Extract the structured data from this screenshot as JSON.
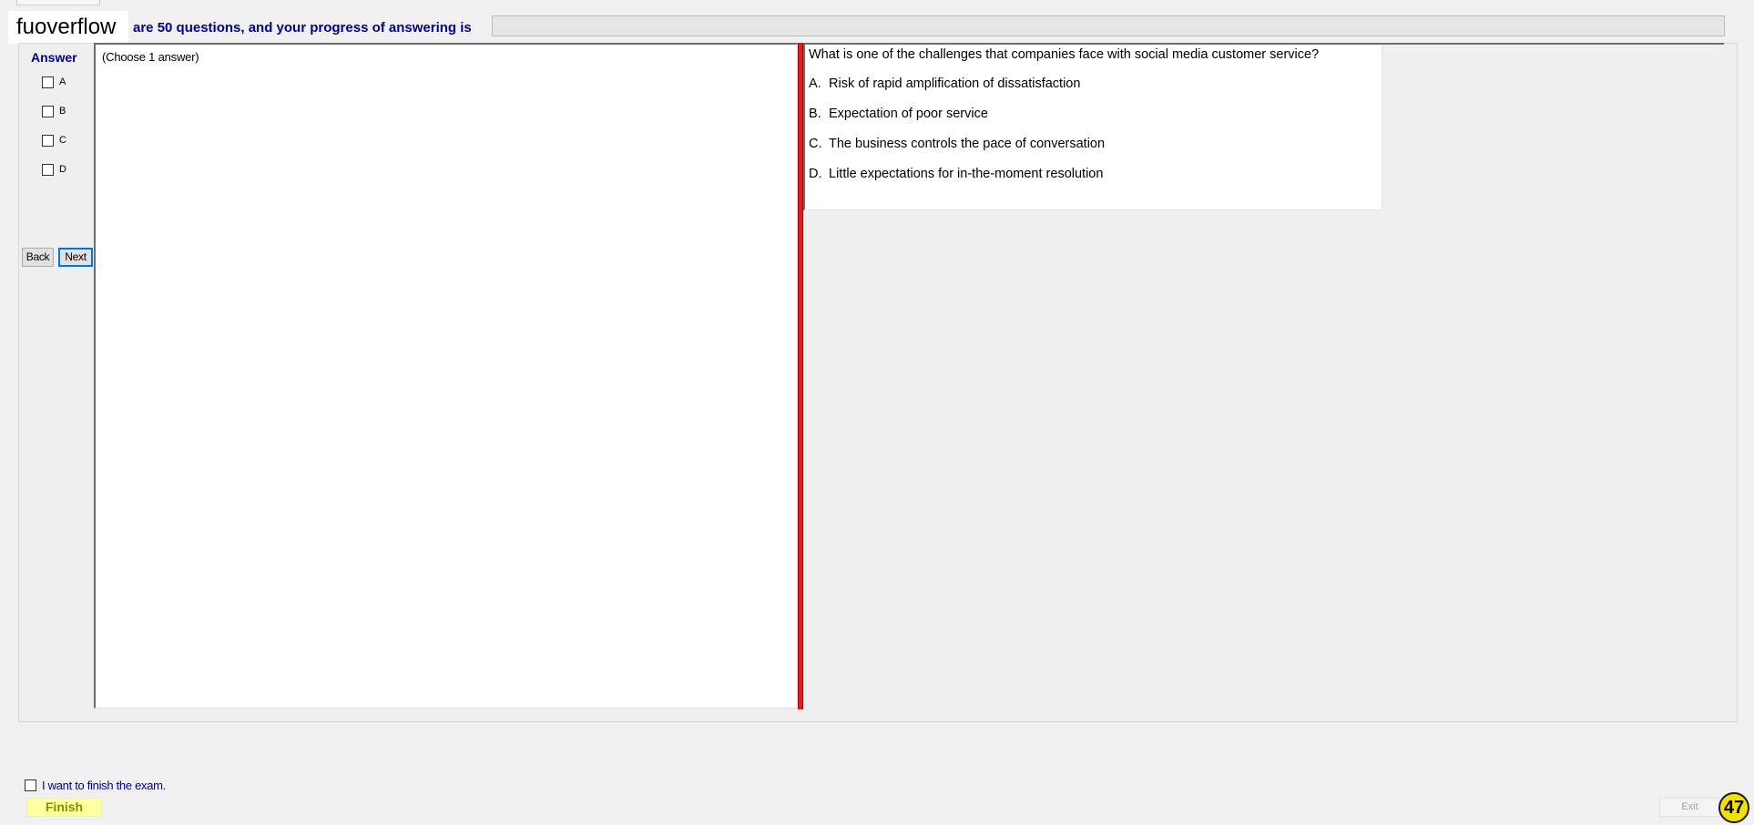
{
  "header": {
    "brand": "fuoverflow",
    "progress_text": "are 50 questions, and your progress of answering is",
    "progress_fraction": 0
  },
  "answer_panel": {
    "title": "Answer",
    "options": [
      "A",
      "B",
      "C",
      "D"
    ],
    "back_label": "Back",
    "next_label": "Next"
  },
  "left_pane": {
    "instruction": "(Choose 1 answer)"
  },
  "question": {
    "text": "What is one of the challenges that companies face with social media customer service?",
    "options": [
      {
        "letter": "A.",
        "text": "Risk of rapid amplification of dissatisfaction"
      },
      {
        "letter": "B.",
        "text": "Expectation of poor service"
      },
      {
        "letter": "C.",
        "text": "The business controls the pace of conversation"
      },
      {
        "letter": "D.",
        "text": "Little expectations for in-the-moment resolution"
      }
    ]
  },
  "footer": {
    "finish_checkbox_label": "I want to finish the exam.",
    "finish_label": "Finish",
    "exit_label": "Exit",
    "question_number": "47"
  },
  "colors": {
    "accent_blue": "#00008b",
    "splitter_red": "#e02020",
    "finish_yellow": "#ffffa0",
    "badge_yellow": "#f5e100"
  }
}
